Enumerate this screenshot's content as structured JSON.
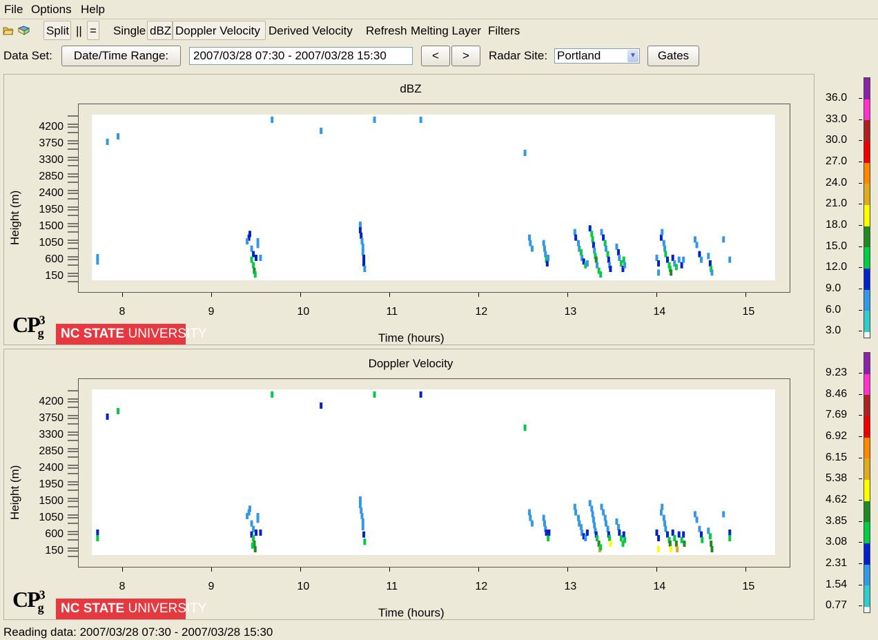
{
  "menu": [
    "File",
    "Options",
    "Help"
  ],
  "toolbar": {
    "split": "Split",
    "vertical_split": "||",
    "horizontal_split": "=",
    "single": "Single",
    "dbz": "dBZ",
    "doppler_velocity": "Doppler Velocity",
    "derived_velocity": "Derived Velocity",
    "refresh": "Refresh",
    "melting_layer": "Melting Layer",
    "filters": "Filters"
  },
  "dataset": {
    "label": "Data Set:",
    "range_button": "Date/Time Range:",
    "range_value": "2007/03/28 07:30 - 2007/03/28 15:30",
    "prev": "<",
    "next": ">",
    "site_label": "Radar Site:",
    "site_value": "Portland",
    "gates_button": "Gates"
  },
  "logo": {
    "cp": "CP",
    "sup": "3",
    "sub": "g",
    "nc_bold": "NC STATE",
    "nc_rest": " UNIVERSITY"
  },
  "colors": {
    "scale": [
      "#33cccc",
      "#3399e6",
      "#0022cc",
      "#00cc44",
      "#228822",
      "#ffff00",
      "#ddaa22",
      "#ff8800",
      "#ee0000",
      "#aa2222",
      "#ff33cc",
      "#8822aa"
    ]
  },
  "chart_data": [
    {
      "type": "heatmap",
      "title": "dBZ",
      "xlabel": "Time (hours)",
      "ylabel": "Height (m)",
      "xlim": [
        7.5,
        15.5
      ],
      "ylim": [
        0,
        4500
      ],
      "x_ticks": [
        "8",
        "9",
        "10",
        "11",
        "12",
        "13",
        "14",
        "15"
      ],
      "y_ticks": [
        "4200",
        "3750",
        "3300",
        "2850",
        "2400",
        "1950",
        "1500",
        "1050",
        "600",
        "150"
      ],
      "legend_ticks": [
        "36.0",
        "33.0",
        "30.0",
        "27.0",
        "24.0",
        "21.0",
        "18.0",
        "15.0",
        "12.0",
        "9.0",
        "6.0",
        "3.0"
      ],
      "points": [
        [
          7.72,
          500,
          1
        ],
        [
          7.72,
          620,
          1
        ],
        [
          7.83,
          3750,
          1
        ],
        [
          7.95,
          3900,
          1
        ],
        [
          9.68,
          4350,
          1
        ],
        [
          10.23,
          4050,
          1
        ],
        [
          10.83,
          4350,
          1
        ],
        [
          11.35,
          4350,
          1
        ],
        [
          12.52,
          3450,
          1
        ],
        [
          9.42,
          1150,
          2
        ],
        [
          9.43,
          1250,
          2
        ],
        [
          9.4,
          1050,
          1
        ],
        [
          9.45,
          850,
          1
        ],
        [
          9.47,
          700,
          2
        ],
        [
          9.45,
          550,
          3
        ],
        [
          9.47,
          400,
          3
        ],
        [
          9.48,
          250,
          4
        ],
        [
          9.49,
          150,
          3
        ],
        [
          9.5,
          600,
          2
        ],
        [
          9.52,
          950,
          1
        ],
        [
          9.52,
          1050,
          1
        ],
        [
          9.55,
          600,
          1
        ],
        [
          10.67,
          1500,
          1
        ],
        [
          10.67,
          1350,
          2
        ],
        [
          10.68,
          1200,
          2
        ],
        [
          10.69,
          1050,
          1
        ],
        [
          10.7,
          900,
          1
        ],
        [
          10.7,
          750,
          1
        ],
        [
          10.71,
          600,
          2
        ],
        [
          10.71,
          450,
          2
        ],
        [
          10.72,
          300,
          1
        ],
        [
          12.57,
          1150,
          1
        ],
        [
          12.58,
          1000,
          1
        ],
        [
          12.6,
          850,
          1
        ],
        [
          12.73,
          1000,
          1
        ],
        [
          12.74,
          850,
          1
        ],
        [
          12.75,
          700,
          1
        ],
        [
          12.76,
          550,
          3
        ],
        [
          12.77,
          450,
          2
        ],
        [
          12.78,
          600,
          1
        ],
        [
          13.08,
          1300,
          1
        ],
        [
          13.09,
          1150,
          2
        ],
        [
          13.12,
          1000,
          1
        ],
        [
          13.13,
          850,
          1
        ],
        [
          13.15,
          750,
          3
        ],
        [
          13.16,
          600,
          1
        ],
        [
          13.18,
          500,
          2
        ],
        [
          13.2,
          400,
          3
        ],
        [
          13.22,
          450,
          1
        ],
        [
          13.25,
          1400,
          2
        ],
        [
          13.27,
          1250,
          3
        ],
        [
          13.28,
          1100,
          3
        ],
        [
          13.29,
          950,
          2
        ],
        [
          13.3,
          800,
          1
        ],
        [
          13.31,
          650,
          3
        ],
        [
          13.32,
          550,
          4
        ],
        [
          13.33,
          400,
          1
        ],
        [
          13.35,
          250,
          3
        ],
        [
          13.37,
          150,
          3
        ],
        [
          13.38,
          1300,
          1
        ],
        [
          13.4,
          1150,
          2
        ],
        [
          13.42,
          1000,
          3
        ],
        [
          13.43,
          850,
          1
        ],
        [
          13.45,
          700,
          3
        ],
        [
          13.46,
          550,
          2
        ],
        [
          13.47,
          400,
          1
        ],
        [
          13.48,
          300,
          2
        ],
        [
          13.55,
          900,
          1
        ],
        [
          13.57,
          750,
          2
        ],
        [
          13.58,
          600,
          1
        ],
        [
          13.6,
          450,
          3
        ],
        [
          13.62,
          300,
          2
        ],
        [
          13.63,
          550,
          3
        ],
        [
          13.64,
          400,
          1
        ],
        [
          14.0,
          600,
          1
        ],
        [
          14.02,
          450,
          2
        ],
        [
          14.02,
          200,
          1
        ],
        [
          14.05,
          1150,
          2
        ],
        [
          14.06,
          1300,
          1
        ],
        [
          14.08,
          1000,
          1
        ],
        [
          14.09,
          850,
          1
        ],
        [
          14.1,
          700,
          3
        ],
        [
          14.12,
          550,
          2
        ],
        [
          14.14,
          400,
          3
        ],
        [
          14.15,
          300,
          3
        ],
        [
          14.16,
          200,
          4
        ],
        [
          14.18,
          600,
          2
        ],
        [
          14.2,
          450,
          1
        ],
        [
          14.22,
          350,
          3
        ],
        [
          14.25,
          550,
          1
        ],
        [
          14.28,
          400,
          2
        ],
        [
          14.3,
          550,
          1
        ],
        [
          14.43,
          1100,
          1
        ],
        [
          14.45,
          950,
          1
        ],
        [
          14.48,
          700,
          2
        ],
        [
          14.5,
          550,
          1
        ],
        [
          14.58,
          650,
          1
        ],
        [
          14.6,
          450,
          2
        ],
        [
          14.61,
          300,
          3
        ],
        [
          14.62,
          200,
          1
        ],
        [
          14.75,
          1100,
          1
        ],
        [
          14.82,
          550,
          1
        ]
      ]
    },
    {
      "type": "heatmap",
      "title": "Doppler Velocity",
      "xlabel": "Time (hours)",
      "ylabel": "Height (m)",
      "xlim": [
        7.5,
        15.5
      ],
      "ylim": [
        0,
        4500
      ],
      "x_ticks": [
        "8",
        "9",
        "10",
        "11",
        "12",
        "13",
        "14",
        "15"
      ],
      "y_ticks": [
        "4200",
        "3750",
        "3300",
        "2850",
        "2400",
        "1950",
        "1500",
        "1050",
        "600",
        "150"
      ],
      "legend_ticks": [
        "9.23",
        "8.46",
        "7.69",
        "6.92",
        "6.15",
        "5.38",
        "4.62",
        "3.85",
        "3.08",
        "2.31",
        "1.54",
        "0.77"
      ],
      "points": [
        [
          7.72,
          600,
          2
        ],
        [
          7.72,
          450,
          3
        ],
        [
          7.83,
          3750,
          2
        ],
        [
          7.95,
          3900,
          3
        ],
        [
          9.68,
          4350,
          3
        ],
        [
          10.23,
          4050,
          2
        ],
        [
          10.83,
          4350,
          3
        ],
        [
          11.35,
          4350,
          2
        ],
        [
          12.52,
          3450,
          3
        ],
        [
          9.42,
          1150,
          1
        ],
        [
          9.43,
          1250,
          1
        ],
        [
          9.4,
          1050,
          1
        ],
        [
          9.45,
          850,
          1
        ],
        [
          9.47,
          700,
          1
        ],
        [
          9.45,
          550,
          2
        ],
        [
          9.47,
          450,
          3
        ],
        [
          9.48,
          300,
          4
        ],
        [
          9.49,
          150,
          4
        ],
        [
          9.5,
          600,
          2
        ],
        [
          9.52,
          950,
          1
        ],
        [
          9.52,
          1050,
          1
        ],
        [
          9.55,
          600,
          2
        ],
        [
          9.46,
          250,
          3
        ],
        [
          10.67,
          1500,
          1
        ],
        [
          10.67,
          1350,
          1
        ],
        [
          10.68,
          1200,
          1
        ],
        [
          10.69,
          1050,
          1
        ],
        [
          10.7,
          900,
          1
        ],
        [
          10.7,
          750,
          1
        ],
        [
          10.71,
          550,
          2
        ],
        [
          10.72,
          350,
          3
        ],
        [
          12.57,
          1150,
          1
        ],
        [
          12.58,
          1000,
          1
        ],
        [
          12.6,
          850,
          1
        ],
        [
          12.73,
          1000,
          1
        ],
        [
          12.74,
          850,
          1
        ],
        [
          12.75,
          700,
          1
        ],
        [
          12.76,
          600,
          2
        ],
        [
          12.78,
          450,
          3
        ],
        [
          12.79,
          600,
          2
        ],
        [
          13.08,
          1300,
          1
        ],
        [
          13.09,
          1150,
          1
        ],
        [
          13.12,
          1000,
          1
        ],
        [
          13.13,
          850,
          1
        ],
        [
          13.15,
          750,
          1
        ],
        [
          13.16,
          600,
          1
        ],
        [
          13.18,
          500,
          2
        ],
        [
          13.2,
          450,
          1
        ],
        [
          13.22,
          600,
          2
        ],
        [
          13.25,
          1400,
          1
        ],
        [
          13.27,
          1250,
          1
        ],
        [
          13.28,
          1100,
          1
        ],
        [
          13.29,
          950,
          1
        ],
        [
          13.3,
          800,
          1
        ],
        [
          13.31,
          650,
          1
        ],
        [
          13.32,
          550,
          2
        ],
        [
          13.33,
          450,
          3
        ],
        [
          13.35,
          300,
          4
        ],
        [
          13.36,
          150,
          6
        ],
        [
          13.37,
          200,
          3
        ],
        [
          13.38,
          1300,
          1
        ],
        [
          13.4,
          1150,
          1
        ],
        [
          13.42,
          1000,
          1
        ],
        [
          13.43,
          850,
          1
        ],
        [
          13.45,
          700,
          1
        ],
        [
          13.46,
          550,
          2
        ],
        [
          13.47,
          450,
          3
        ],
        [
          13.48,
          300,
          5
        ],
        [
          13.55,
          900,
          1
        ],
        [
          13.57,
          750,
          1
        ],
        [
          13.58,
          600,
          2
        ],
        [
          13.6,
          450,
          3
        ],
        [
          13.62,
          300,
          3
        ],
        [
          13.63,
          550,
          2
        ],
        [
          13.64,
          400,
          3
        ],
        [
          14.0,
          600,
          2
        ],
        [
          14.02,
          450,
          2
        ],
        [
          14.02,
          150,
          5
        ],
        [
          14.05,
          1150,
          1
        ],
        [
          14.06,
          1300,
          1
        ],
        [
          14.08,
          1000,
          1
        ],
        [
          14.09,
          850,
          1
        ],
        [
          14.1,
          700,
          1
        ],
        [
          14.12,
          550,
          2
        ],
        [
          14.14,
          400,
          3
        ],
        [
          14.15,
          300,
          4
        ],
        [
          14.16,
          150,
          5
        ],
        [
          14.18,
          600,
          2
        ],
        [
          14.2,
          450,
          3
        ],
        [
          14.22,
          300,
          4
        ],
        [
          14.23,
          150,
          6
        ],
        [
          14.25,
          550,
          2
        ],
        [
          14.28,
          400,
          3
        ],
        [
          14.3,
          550,
          2
        ],
        [
          14.31,
          300,
          4
        ],
        [
          14.43,
          1100,
          1
        ],
        [
          14.45,
          950,
          1
        ],
        [
          14.48,
          700,
          1
        ],
        [
          14.5,
          550,
          2
        ],
        [
          14.51,
          400,
          3
        ],
        [
          14.58,
          650,
          1
        ],
        [
          14.6,
          500,
          3
        ],
        [
          14.61,
          300,
          4
        ],
        [
          14.62,
          150,
          4
        ],
        [
          14.75,
          1100,
          1
        ],
        [
          14.82,
          600,
          2
        ],
        [
          14.82,
          450,
          3
        ]
      ]
    }
  ],
  "status": "Reading data: 2007/03/28 07:30 - 2007/03/28 15:30"
}
